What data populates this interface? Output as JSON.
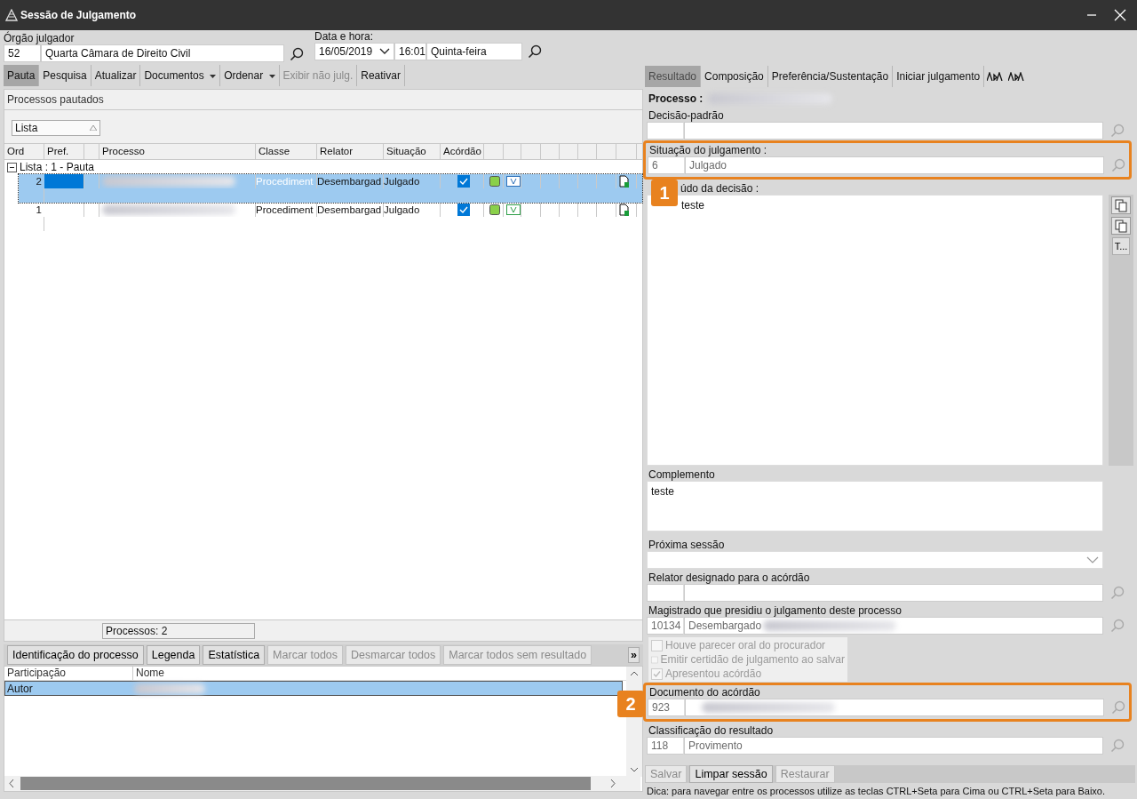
{
  "window": {
    "title": "Sessão de Julgamento"
  },
  "header": {
    "orgao": {
      "label": "Órgão julgador",
      "code": "52",
      "name": "Quarta Câmara de Direito Civil"
    },
    "data_hora": {
      "label": "Data e hora:",
      "date": "16/05/2019",
      "time": "16:01",
      "weekday": "Quinta-feira"
    }
  },
  "toolbar": [
    {
      "label": "Pauta",
      "selected": true,
      "disabled": false,
      "dropdown": false
    },
    {
      "label": "Pesquisa",
      "selected": false,
      "disabled": false,
      "dropdown": false
    },
    {
      "label": "Atualizar",
      "selected": false,
      "disabled": false,
      "dropdown": false
    },
    {
      "label": "Documentos",
      "selected": false,
      "disabled": false,
      "dropdown": true
    },
    {
      "label": "Ordenar",
      "selected": false,
      "disabled": false,
      "dropdown": true
    },
    {
      "label": "Exibir não julg.",
      "selected": false,
      "disabled": true,
      "dropdown": false
    },
    {
      "label": "Reativar",
      "selected": false,
      "disabled": false,
      "dropdown": false
    }
  ],
  "grid": {
    "title": "Processos pautados",
    "group_by": "Lista",
    "columns": [
      "Ord",
      "Pref.",
      "Processo",
      "Classe",
      "Relator",
      "Situação",
      "Acórdão"
    ],
    "group": {
      "label": "Lista : 1 - Pauta",
      "expanded": true
    },
    "rows": [
      {
        "ord": "2",
        "classe": "Procediment",
        "relator": "Desembargad",
        "situacao": "Julgado",
        "acordao": true,
        "selected": true
      },
      {
        "ord": "1",
        "classe": "Procediment",
        "relator": "Desembargad",
        "situacao": "Julgado",
        "acordao": true,
        "selected": false
      }
    ],
    "footer": "Processos: 2"
  },
  "bottom_tabs": [
    {
      "label": "Identificação do processo",
      "disabled": false
    },
    {
      "label": "Legenda",
      "disabled": false
    },
    {
      "label": "Estatística",
      "disabled": false
    },
    {
      "label": "Marcar todos",
      "disabled": true
    },
    {
      "label": "Desmarcar todos",
      "disabled": true
    },
    {
      "label": "Marcar todos sem resultado",
      "disabled": true
    }
  ],
  "overflow_button": "»",
  "participants": {
    "columns": [
      "Participação",
      "Nome"
    ],
    "rows": [
      {
        "participacao": "Autor",
        "selected": true
      }
    ]
  },
  "right_tabs": [
    {
      "label": "Resultado",
      "selected": true
    },
    {
      "label": "Composição",
      "selected": false
    },
    {
      "label": "Preferência/Sustentação",
      "selected": false
    },
    {
      "label": "Iniciar julgamento",
      "selected": false
    }
  ],
  "processo_label": "Processo :",
  "fields": [
    {
      "kind": "lookup",
      "label": "Decisão-padrão"
    },
    {
      "kind": "lookup",
      "label": "Situação do julgamento :",
      "code": "6",
      "value": "Julgado",
      "callout": {
        "number": "1"
      }
    },
    {
      "kind": "textarea",
      "label": "údo da decisão :",
      "value": "teste",
      "tools": [
        "T..."
      ]
    },
    {
      "kind": "textarea",
      "label": "Complemento",
      "value": "teste"
    },
    {
      "kind": "select",
      "label": "Próxima sessão"
    },
    {
      "kind": "lookup",
      "label": "Relator designado para o acórdão"
    },
    {
      "kind": "lookup",
      "label": "Magistrado que presidiu o julgamento deste processo",
      "code": "10134",
      "value": "Desembargado",
      "redacted": true
    },
    {
      "kind": "checks",
      "disabled": true,
      "items": [
        {
          "label": "Houve parecer oral do procurador",
          "checked": false
        },
        {
          "label": "Emitir certidão de julgamento ao salvar",
          "checked": false
        },
        {
          "label": "Apresentou acórdão",
          "checked": true
        }
      ]
    },
    {
      "kind": "lookup",
      "label": "Documento do acórdão",
      "code": "923",
      "redacted": true,
      "callout": {
        "number": "2"
      }
    },
    {
      "kind": "lookup",
      "label": "Classificação do resultado",
      "code": "118",
      "value": "Provimento"
    }
  ],
  "actions": [
    {
      "label": "Salvar",
      "disabled": true
    },
    {
      "label": "Limpar sessão",
      "disabled": false
    },
    {
      "label": "Restaurar",
      "disabled": true
    }
  ],
  "hint": "Dica: para navegar entre os processos utilize as teclas CTRL+Seta para Cima ou CTRL+Seta para Baixo."
}
